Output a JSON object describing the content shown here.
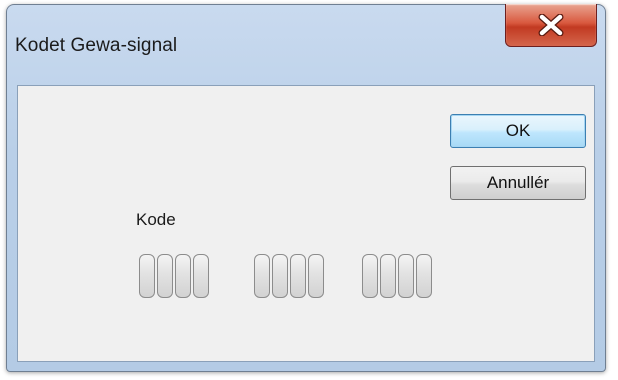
{
  "window": {
    "title": "Kodet Gewa-signal",
    "close_icon": "close-icon"
  },
  "buttons": {
    "ok_label": "OK",
    "cancel_label": "Annullér"
  },
  "code": {
    "label": "Kode",
    "groups": [
      [
        "",
        "",
        "",
        ""
      ],
      [
        "",
        "",
        "",
        ""
      ],
      [
        "",
        "",
        "",
        ""
      ]
    ]
  },
  "colors": {
    "close_button": "#d9593f",
    "ok_highlight": "#3c7fb1",
    "client_background": "#f0f0f0"
  }
}
